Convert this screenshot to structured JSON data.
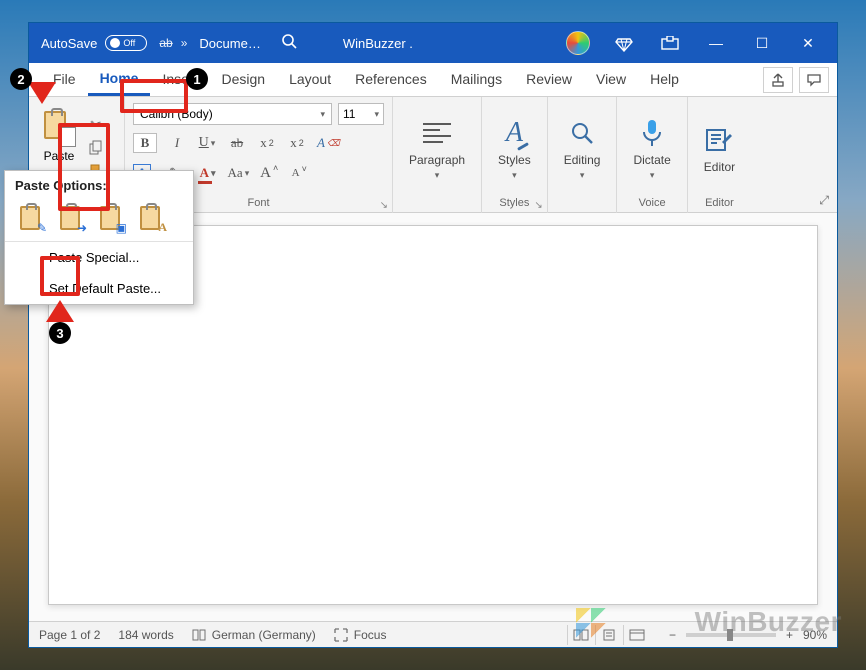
{
  "titlebar": {
    "autosave_label": "AutoSave",
    "autosave_state": "Off",
    "doc_title": "Docume…",
    "site_label": "WinBuzzer .",
    "buttons": {
      "minimize": "—",
      "maximize": "☐",
      "close": "✕"
    }
  },
  "tabs": {
    "items": [
      "File",
      "Home",
      "Insert",
      "Design",
      "Layout",
      "References",
      "Mailings",
      "Review",
      "View",
      "Help"
    ],
    "active_index": 1
  },
  "ribbon": {
    "paste_label": "Paste",
    "font": {
      "name": "Calibri (Body)",
      "size": "11",
      "group_label": "Font"
    },
    "paragraph": {
      "label": "Paragraph"
    },
    "styles": {
      "label": "Styles",
      "group_label": "Styles"
    },
    "editing": {
      "label": "Editing"
    },
    "dictate": {
      "label": "Dictate",
      "group_label": "Voice"
    },
    "editor": {
      "label": "Editor",
      "group_label": "Editor"
    }
  },
  "paste_menu": {
    "header": "Paste Options:",
    "special": "Paste Special...",
    "default": "Set Default Paste..."
  },
  "statusbar": {
    "page": "Page 1 of 2",
    "words": "184 words",
    "language": "German (Germany)",
    "focus": "Focus",
    "zoom": "90%"
  },
  "annotations": {
    "n1": "1",
    "n2": "2",
    "n3": "3"
  },
  "watermark": "WinBuzzer"
}
